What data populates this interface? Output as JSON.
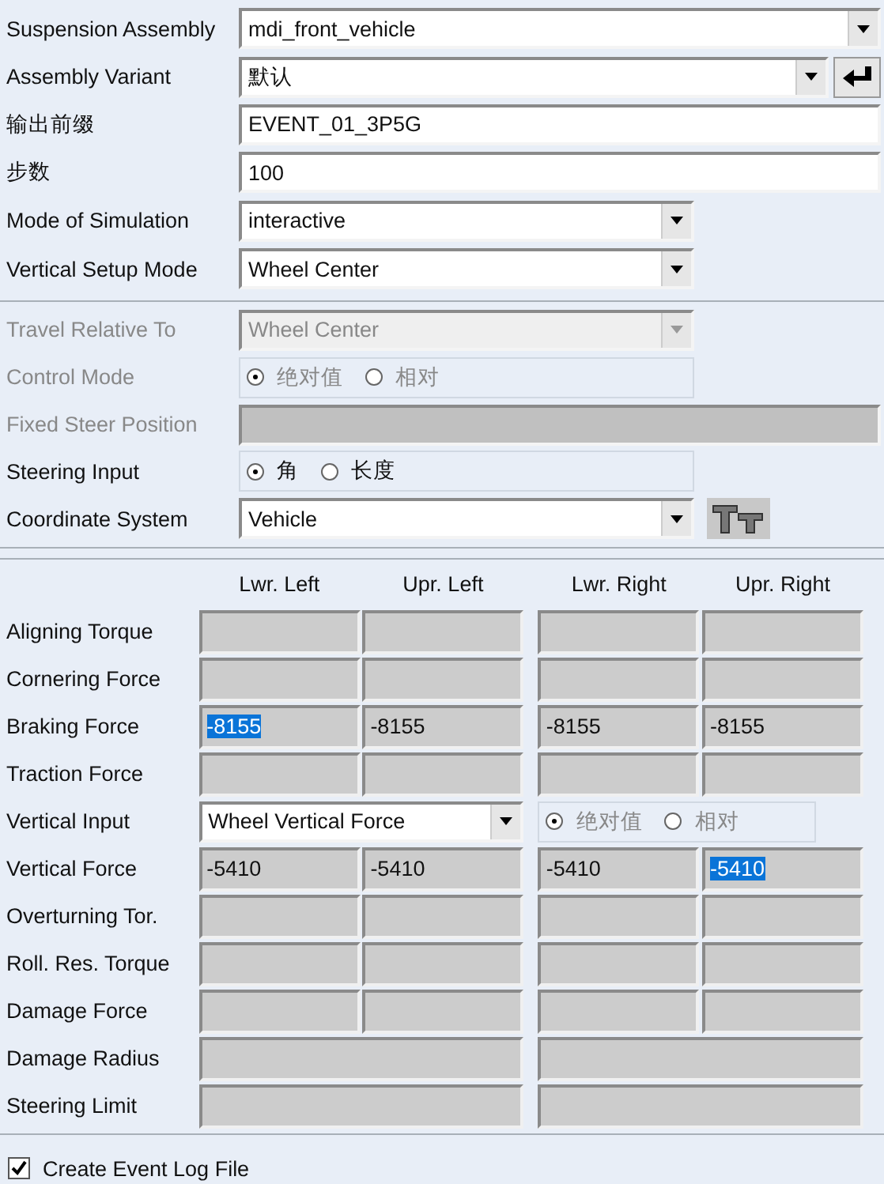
{
  "top_fields": [
    {
      "kind": "assembly_select",
      "label": "Suspension Assembly",
      "value": "mdi_front_vehicle"
    },
    {
      "kind": "variant_select",
      "label": "Assembly Variant",
      "value": "默认"
    },
    {
      "kind": "text",
      "label": "输出前缀",
      "value": "EVENT_01_3P5G"
    },
    {
      "kind": "text",
      "label": "步数",
      "value": "100"
    },
    {
      "kind": "dropdown",
      "label": "Mode of Simulation",
      "value": "interactive"
    },
    {
      "kind": "dropdown",
      "label": "Vertical Setup Mode",
      "value": "Wheel Center"
    }
  ],
  "setup_fields": [
    {
      "kind": "dropdown",
      "label": "Travel Relative To",
      "value": "Wheel Center",
      "disabled": true
    },
    {
      "kind": "radio",
      "label": "Control Mode",
      "disabled": true,
      "options": [
        {
          "label": "绝对值",
          "selected": true
        },
        {
          "label": "相对",
          "selected": false
        }
      ]
    },
    {
      "kind": "text",
      "label": "Fixed Steer Position",
      "disabled": true
    },
    {
      "kind": "radio",
      "label": "Steering Input",
      "disabled": false,
      "options": [
        {
          "label": "角",
          "selected": true
        },
        {
          "label": "长度",
          "selected": false
        }
      ]
    },
    {
      "kind": "dropdown_tool",
      "label": "Coordinate System",
      "value": "Vehicle",
      "disabled": false
    }
  ],
  "table": {
    "columns": [
      "Lwr. Left",
      "Upr. Left",
      "Lwr. Right",
      "Upr. Right"
    ],
    "rows": [
      {
        "kind": "empty_quad",
        "label": "Aligning Torque"
      },
      {
        "kind": "empty_quad",
        "label": "Cornering Force"
      },
      {
        "kind": "quad",
        "label": "Braking Force",
        "cells": [
          {
            "value": "-8155",
            "selected": true
          },
          {
            "value": "-8155",
            "selected": false
          },
          {
            "value": "-8155",
            "selected": false
          },
          {
            "value": "-8155",
            "selected": false
          }
        ]
      },
      {
        "kind": "empty_quad",
        "label": "Traction Force"
      },
      {
        "kind": "input_select",
        "label": "Vertical Input",
        "value": "Wheel Vertical Force",
        "disabled": true,
        "options": [
          {
            "label": "绝对值",
            "selected": true
          },
          {
            "label": "相对",
            "selected": false
          }
        ]
      },
      {
        "kind": "quad",
        "label": "Vertical Force",
        "cells": [
          {
            "value": "-5410",
            "selected": false
          },
          {
            "value": "-5410",
            "selected": false
          },
          {
            "value": "-5410",
            "selected": false
          },
          {
            "value": "-5410",
            "selected": true
          }
        ]
      },
      {
        "kind": "empty_quad",
        "label": "Overturning Tor."
      },
      {
        "kind": "empty_quad",
        "label": "Roll. Res. Torque"
      },
      {
        "kind": "empty_quad",
        "label": "Damage Force"
      },
      {
        "kind": "empty_pair",
        "label": "Damage Radius"
      },
      {
        "kind": "empty_pair",
        "label": "Steering Limit"
      }
    ]
  },
  "log_file": {
    "label": "Create Event Log File",
    "checked": true
  }
}
